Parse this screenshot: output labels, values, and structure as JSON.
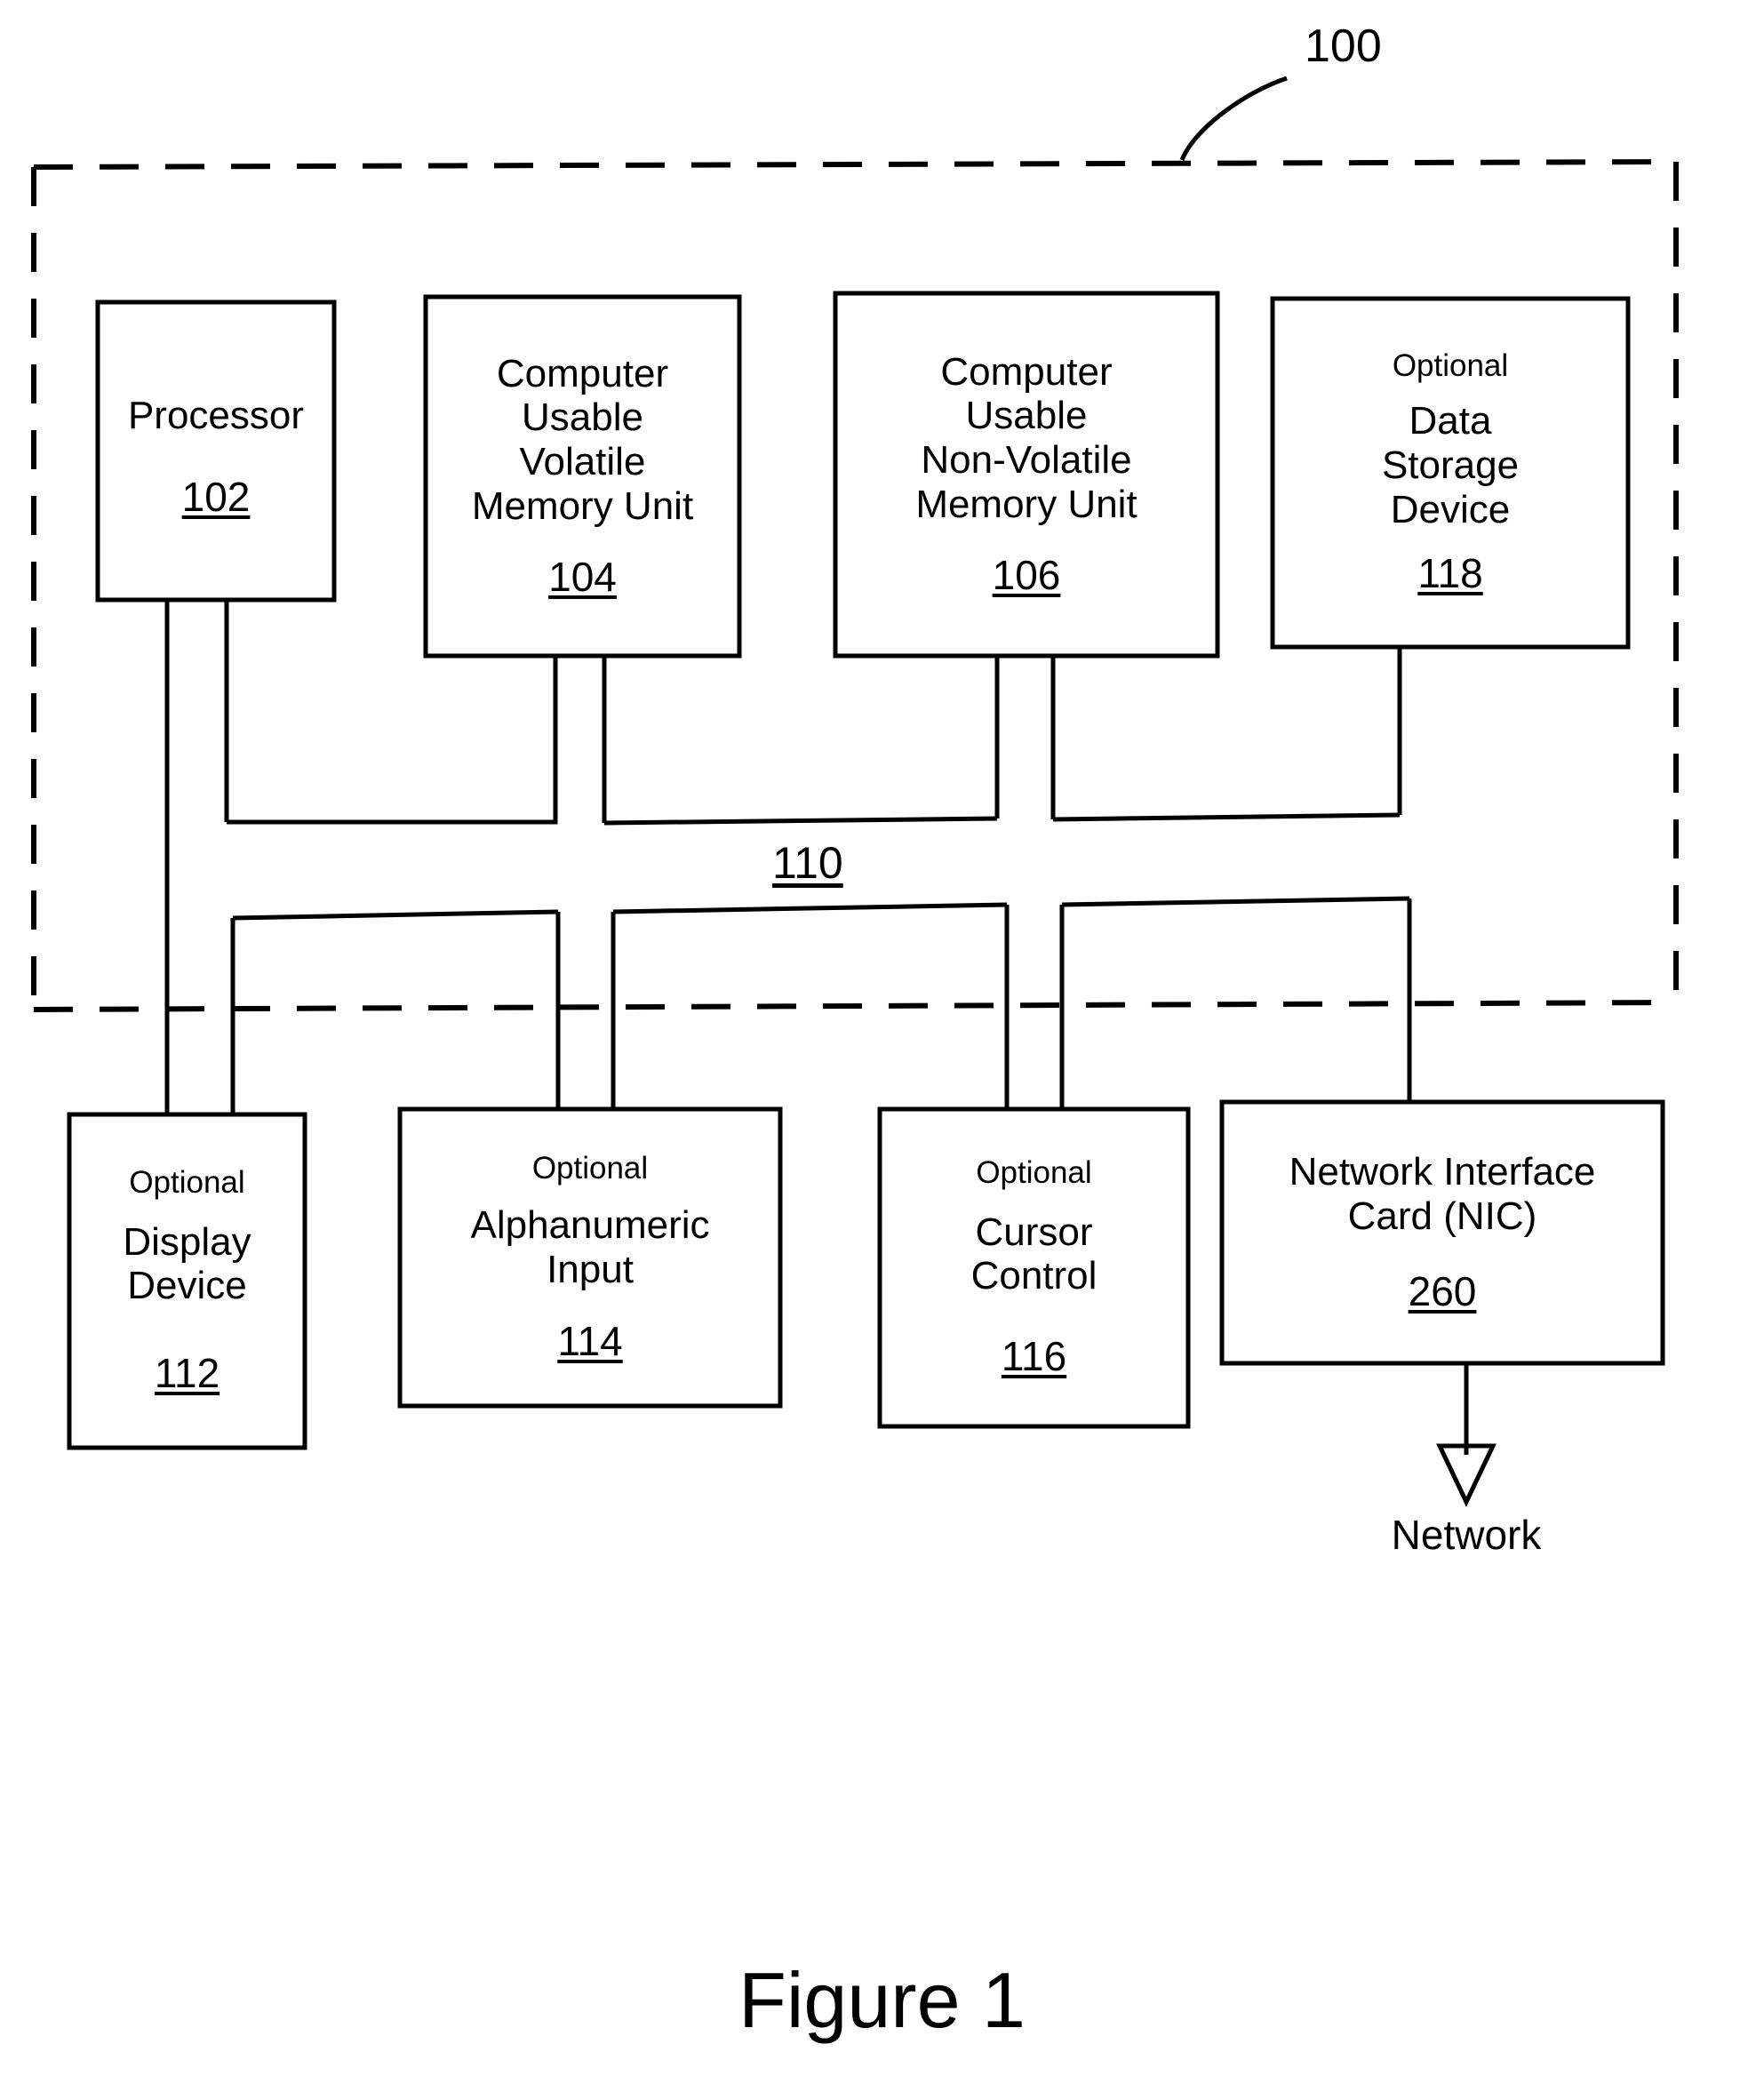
{
  "figure": {
    "caption": "Figure 1",
    "system_callout": "100",
    "bus_ref": "110",
    "network_label": "Network"
  },
  "internal_blocks": [
    {
      "id": "processor",
      "optional": "",
      "title": "Processor",
      "ref": "102"
    },
    {
      "id": "volatile-memory",
      "optional": "",
      "title": "Computer\nUsable\nVolatile\nMemory Unit",
      "ref": "104"
    },
    {
      "id": "non-volatile-memory",
      "optional": "",
      "title": "Computer\nUsable\nNon-Volatile\nMemory Unit",
      "ref": "106"
    },
    {
      "id": "data-storage",
      "optional": "Optional",
      "title": "Data\nStorage\nDevice",
      "ref": "118"
    }
  ],
  "peripheral_blocks": [
    {
      "id": "display-device",
      "optional": "Optional",
      "title": "Display\nDevice",
      "ref": "112"
    },
    {
      "id": "alphanumeric-input",
      "optional": "Optional",
      "title": "Alphanumeric\nInput",
      "ref": "114"
    },
    {
      "id": "cursor-control",
      "optional": "Optional",
      "title": "Cursor\nControl",
      "ref": "116"
    },
    {
      "id": "network-interface-card",
      "optional": "",
      "title": "Network Interface\nCard (NIC)",
      "ref": "260"
    }
  ],
  "colors": {
    "ink": "#000000",
    "paper": "#ffffff"
  }
}
